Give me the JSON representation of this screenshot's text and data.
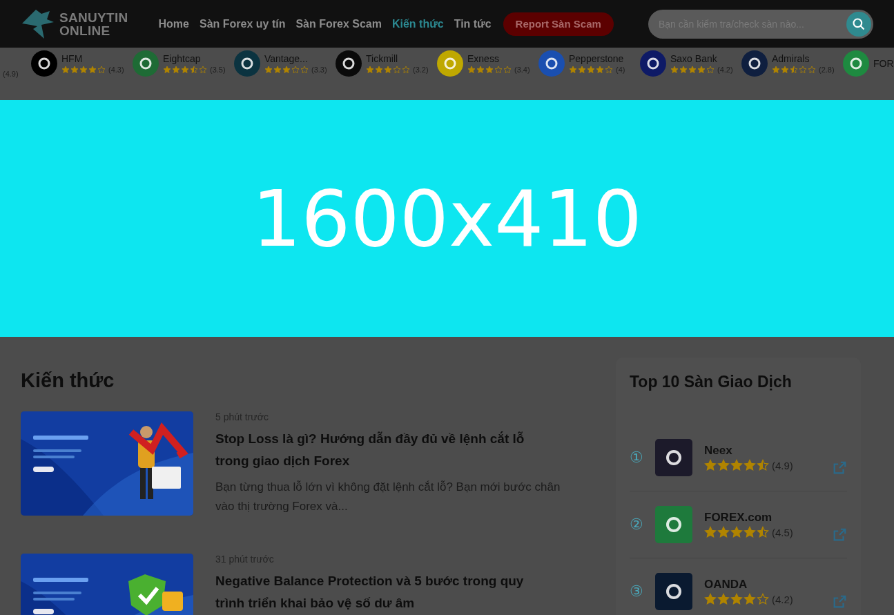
{
  "header": {
    "logo_lines": [
      "SANUYTIN",
      "ONLINE"
    ],
    "nav": [
      {
        "label": "Home",
        "selected": false
      },
      {
        "label": "Sàn Forex uy tín",
        "selected": false
      },
      {
        "label": "Sàn Forex Scam",
        "selected": false
      },
      {
        "label": "Kiến thức",
        "selected": true
      },
      {
        "label": "Tin tức",
        "selected": false
      }
    ],
    "report_button": "Report Sàn Scam",
    "search": {
      "placeholder": "Bạn cần kiểm tra/check sàn nào..."
    }
  },
  "brokers": [
    {
      "rating": "(4.9)"
    },
    {
      "name": "HFM",
      "color": "#000000",
      "stars": 4,
      "rating": "(4.3)"
    },
    {
      "name": "Eightcap",
      "color": "#1e6b35",
      "stars": 3.5,
      "rating": "(3.5)"
    },
    {
      "name": "Vantage...",
      "color": "#0b3340",
      "stars": 3,
      "rating": "(3.3)"
    },
    {
      "name": "Tickmill",
      "color": "#0a0a0a",
      "stars": 3,
      "rating": "(3.2)"
    },
    {
      "name": "Exness",
      "color": "#bfa800",
      "stars": 3,
      "rating": "(3.4)"
    },
    {
      "name": "Pepperstone",
      "color": "#1a4fb0",
      "stars": 4,
      "rating": "(4)"
    },
    {
      "name": "Saxo Bank",
      "color": "#0e1a66",
      "stars": 4,
      "rating": "(4.2)"
    },
    {
      "name": "Admirals",
      "color": "#0f1f3f",
      "stars": 2.5,
      "rating": "(2.8)"
    },
    {
      "name": "FOR",
      "color": "#1e8a40"
    }
  ],
  "banner": {
    "label": "1600x410"
  },
  "section_title": "Kiến thức",
  "articles": [
    {
      "time": "5 phút trước",
      "title": "Stop Loss là gì? Hướng dẫn đầy đủ về lệnh cắt lỗ trong giao dịch Forex",
      "excerpt": "Bạn từng thua lỗ lớn vì không đặt lệnh cắt lỗ? Bạn mới bước chân vào thị trường Forex và..."
    },
    {
      "time": "31 phút trước",
      "title": "Negative Balance Protection và 5 bước trong quy trình triển khai bảo vệ số dư âm"
    }
  ],
  "sidebar": {
    "title": "Top 10 Sàn Giao Dịch",
    "items": [
      {
        "rank": "①",
        "name": "Neex",
        "color": "#1c1a2a",
        "stars": 4.5,
        "rating": "(4.9)"
      },
      {
        "rank": "②",
        "name": "FOREX.com",
        "color": "#1e7a3c",
        "stars": 4.5,
        "rating": "(4.5)"
      },
      {
        "rank": "③",
        "name": "OANDA",
        "color": "#0a1a30",
        "stars": 4,
        "rating": "(4.2)"
      }
    ]
  }
}
